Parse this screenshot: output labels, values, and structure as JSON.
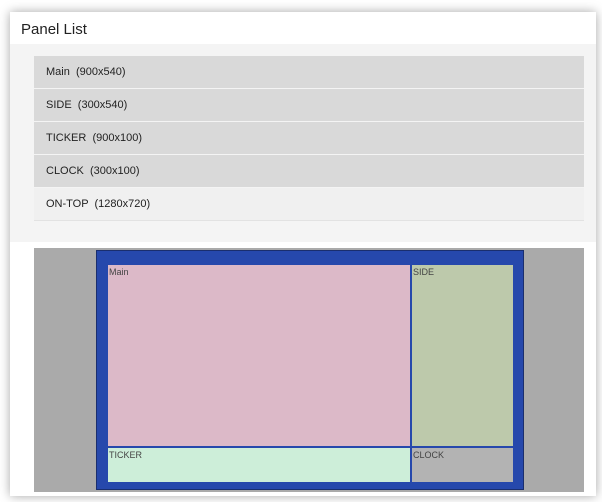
{
  "window": {
    "title": "Panel List"
  },
  "panels": [
    {
      "label": "Main  (900x540)"
    },
    {
      "label": "SIDE  (300x540)"
    },
    {
      "label": "TICKER  (900x100)"
    },
    {
      "label": "CLOCK  (300x100)"
    },
    {
      "label": "ON-TOP  (1280x720)"
    }
  ],
  "preview": {
    "regions": {
      "main": "Main",
      "side": "SIDE",
      "ticker": "TICKER",
      "clock": "CLOCK"
    }
  },
  "colors": {
    "screen_bg": "#2648ac",
    "main": "#dcb9c8",
    "side": "#bdc9ab",
    "ticker": "#cdeed9",
    "clock": "#b3b3b3",
    "preview_bg": "#aaaaaa"
  }
}
